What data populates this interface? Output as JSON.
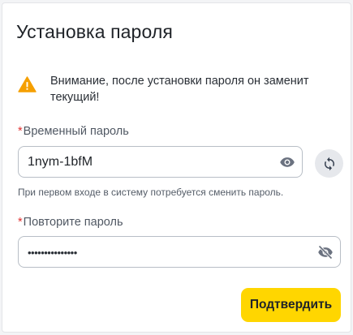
{
  "dialog": {
    "title": "Установка пароля",
    "warning_text": "Внимание, после установки пароля он заменит текущий!"
  },
  "temp_password": {
    "required_mark": "*",
    "label": "Временный пароль",
    "value": "1nym-1bfM",
    "visibility_icon": "eye-icon",
    "regenerate_icon": "refresh-icon",
    "hint": "При первом входе в систему потребуется сменить пароль."
  },
  "repeat_password": {
    "required_mark": "*",
    "label": "Повторите пароль",
    "masked_value": "•••••••••••••••",
    "visibility_icon": "eye-off-icon"
  },
  "actions": {
    "submit_label": "Подтвердить"
  },
  "colors": {
    "accent": "#ffd600",
    "warning": "#f59f00",
    "required": "#e03131"
  }
}
